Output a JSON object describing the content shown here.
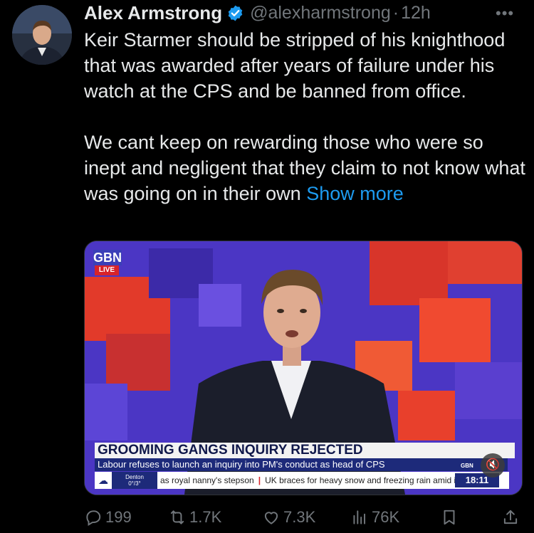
{
  "tweet": {
    "author_name": "Alex Armstrong",
    "handle": "@alexharmstrong",
    "separator": "·",
    "time": "12h",
    "more_glyph": "•••",
    "paragraph1": "Keir Starmer should be stripped of his knighthood that was awarded after years of failure under his watch at the CPS and be banned from office.",
    "paragraph2": "We cant keep on rewarding those who were so inept and negligent that they claim to not know what was going on in their own ",
    "show_more": "Show more"
  },
  "media": {
    "channel_logo": "GBN",
    "live_label": "LIVE",
    "headline": "GROOMING GANGS INQUIRY REJECTED",
    "subheadline": "Labour refuses to launch an inquiry into PM's conduct as head of CPS",
    "weather_place": "Denton",
    "weather_temp": "0°/3°",
    "ticker_left": "as royal nanny's stepson",
    "ticker_sep": "|",
    "ticker_right": "UK braces for heavy snow and freezing rain amid i",
    "clock": "18:11",
    "badge": "GBN",
    "mute_glyph": "🔇"
  },
  "actions": {
    "replies": "199",
    "reposts": "1.7K",
    "likes": "7.3K",
    "views": "76K"
  },
  "colors": {
    "background": "#000000",
    "text": "#e7e9ea",
    "muted": "#71767b",
    "link": "#1d9bf0",
    "verified": "#1d9bf0"
  }
}
